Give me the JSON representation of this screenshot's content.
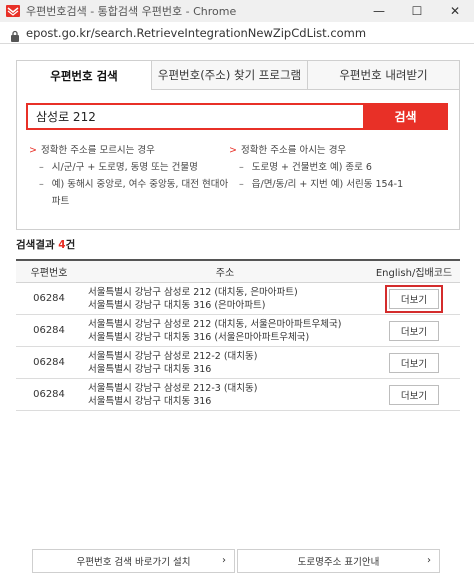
{
  "window": {
    "title": "우편번호검색 - 통합검색 우편번호 - Chrome",
    "url": "epost.go.kr/search.RetrieveIntegrationNewZipCdList.comm",
    "minimize_glyph": "—",
    "maximize_glyph": "☐",
    "close_glyph": "✕"
  },
  "colors": {
    "accent": "#e83027",
    "highlight": "#d42c2c"
  },
  "tabs": [
    {
      "label": "우편번호 검색",
      "active": true
    },
    {
      "label": "우편번호(주소) 찾기 프로그램",
      "active": false
    },
    {
      "label": "우편번호 내려받기",
      "active": false
    }
  ],
  "search": {
    "value": "삼성로 212",
    "button_label": "검색"
  },
  "help": {
    "left": {
      "heading": "정확한 주소를 모르시는 경우",
      "items": [
        "시/군/구 + 도로명, 동명 또는 건물명",
        "예) 동해시 중앙로, 여수 중앙동, 대전 현대아파트"
      ]
    },
    "right": {
      "heading": "정확한 주소를 아시는 경우",
      "items": [
        "도로명 + 건물번호 예) 종로 6",
        "읍/면/동/리 + 지번 예) 서린동 154-1"
      ]
    }
  },
  "results": {
    "label": "검색결과",
    "count": "4",
    "unit": "건",
    "columns": [
      "우편번호",
      "주소",
      "English/집배코드"
    ],
    "more_label": "더보기",
    "rows": [
      {
        "zip": "06284",
        "road": "서울특별시 강남구 삼성로 212 (대치동, 은마아파트)",
        "jibun": "서울특별시 강남구 대치동 316 (은마아파트)",
        "highlighted": true
      },
      {
        "zip": "06284",
        "road": "서울특별시 강남구 삼성로 212 (대치동, 서울은마아파트우체국)",
        "jibun": "서울특별시 강남구 대치동 316 (서울은마아파트우체국)",
        "highlighted": false
      },
      {
        "zip": "06284",
        "road": "서울특별시 강남구 삼성로 212-2 (대치동)",
        "jibun": "서울특별시 강남구 대치동 316",
        "highlighted": false
      },
      {
        "zip": "06284",
        "road": "서울특별시 강남구 삼성로 212-3 (대치동)",
        "jibun": "서울특별시 강남구 대치동 316",
        "highlighted": false
      }
    ]
  },
  "footer": {
    "buttons": [
      "우편번호 검색 바로가기 설치",
      "도로명주소 표기안내"
    ]
  }
}
